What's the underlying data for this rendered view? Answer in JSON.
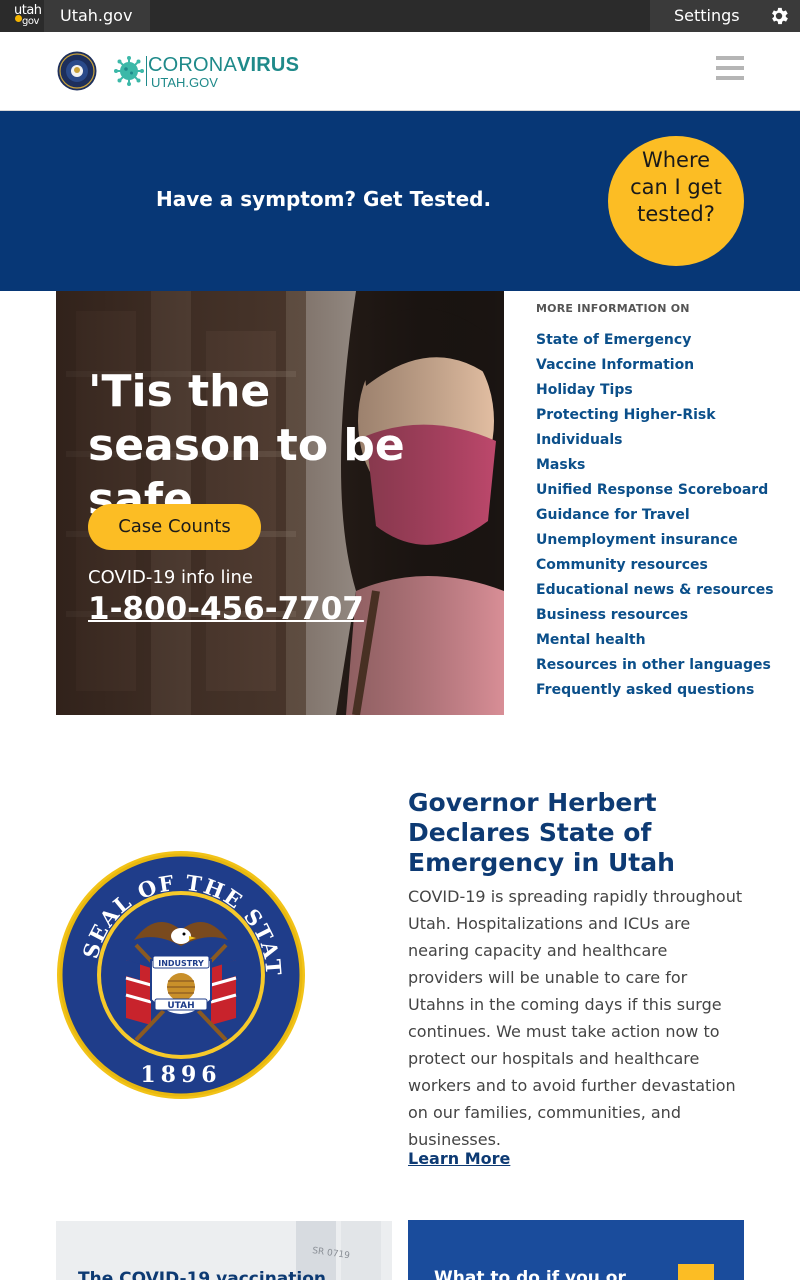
{
  "topbar": {
    "logo_top": "utah",
    "logo_bottom": "gov",
    "site_link": "Utah.gov",
    "settings_label": "Settings",
    "settings_icon": "gear-icon"
  },
  "header": {
    "brand_light": "CORONA",
    "brand_bold": "VIRUS",
    "brand_sub": "UTAH.GOV",
    "menu_icon": "hamburger-icon"
  },
  "banner": {
    "text": "Have a symptom? Get Tested.",
    "button_label": "Where can I get tested?"
  },
  "hero": {
    "title": "'Tis the season to be safe",
    "cta_label": "Case Counts",
    "info_label": "COVID-19 info line",
    "phone": "1-800-456-7707"
  },
  "more_info": {
    "heading": "MORE INFORMATION ON",
    "links": [
      "State of Emergency",
      "Vaccine Information",
      "Holiday Tips",
      "Protecting Higher-Risk Individuals",
      "Masks",
      "Unified Response Scoreboard",
      "Guidance for Travel",
      "Unemployment insurance",
      "Community resources",
      "Educational news & resources",
      "Business resources",
      "Mental health",
      "Resources in other languages",
      "Frequently asked questions"
    ]
  },
  "article": {
    "seal_top_text": "THE GREAT SEAL OF THE STATE OF UTAH",
    "seal_year": "1896",
    "seal_banner": "INDUSTRY",
    "seal_name": "UTAH",
    "seal_small_year": "1847",
    "title": "Governor Herbert Declares State of Emergency in Utah",
    "body": "COVID-19 is spreading rapidly throughout Utah. Hospitalizations and ICUs are nearing capacity and healthcare providers will be unable to care for Utahns in the coming days if this surge continues. We must take action now to protect our hospitals and healthcare workers and to avoid further devastation on our families, communities, and businesses.",
    "link": "Learn More"
  },
  "cards": {
    "left_text": "The COVID-19 vaccination",
    "right_text": "What to do if you or"
  },
  "colors": {
    "banner_blue": "#073776",
    "accent_yellow": "#fcbd24",
    "link_blue": "#0b4f8a",
    "brand_teal": "#1f8a8a"
  }
}
